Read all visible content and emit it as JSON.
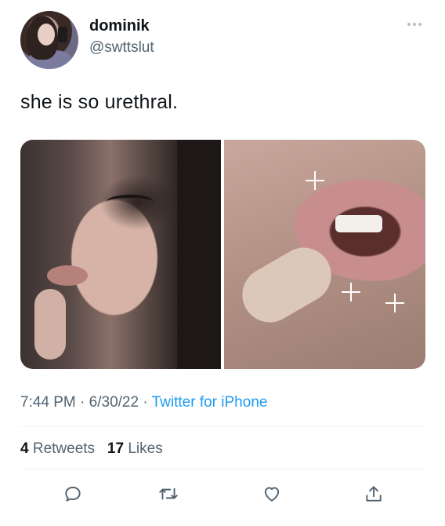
{
  "author": {
    "name": "dominik",
    "handle": "@swttslut"
  },
  "tweet": {
    "text": "she is so urethral."
  },
  "media": {
    "count": 2
  },
  "meta": {
    "time": "7:44 PM",
    "separator": " · ",
    "date": "6/30/22",
    "separator2": " · ",
    "source": "Twitter for iPhone"
  },
  "stats": {
    "retweets_count": "4",
    "retweets_label": "Retweets",
    "likes_count": "17",
    "likes_label": "Likes"
  },
  "actions": [
    "reply-icon",
    "retweet-icon",
    "like-icon",
    "share-icon"
  ],
  "colors": {
    "text": "#0f1419",
    "secondary": "#536471",
    "link": "#1d9bf0",
    "divider": "#eff3f4"
  }
}
